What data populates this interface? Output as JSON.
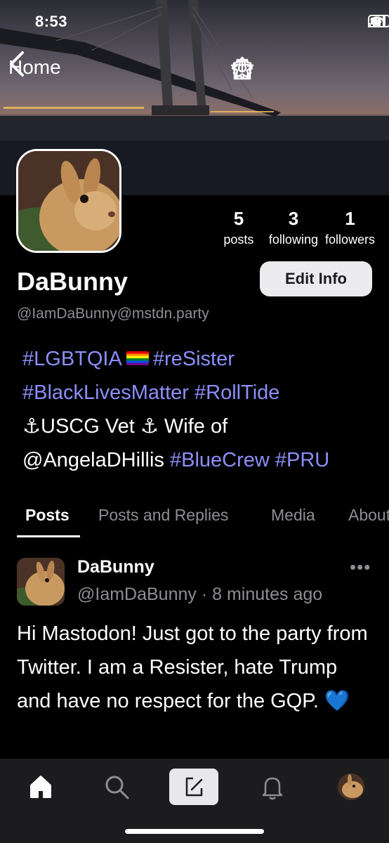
{
  "status": {
    "time": "8:53"
  },
  "nav": {
    "back_label": "Home"
  },
  "profile": {
    "display_name": "DaBunny",
    "handle": "@IamDaBunny@mstdn.party",
    "edit_label": "Edit Info",
    "stats": [
      {
        "value": "5",
        "label": "posts"
      },
      {
        "value": "3",
        "label": "following"
      },
      {
        "value": "1",
        "label": "followers"
      }
    ],
    "bio": {
      "tag_lgbtqia": "#LGBTQIA",
      "tag_resister": "#reSister",
      "tag_blm": "#BlackLivesMatter",
      "tag_rolltide": "#RollTide",
      "line3": "⚓USCG Vet ⚓ Wife of",
      "mention": "@AngelaDHillis",
      "tag_bluecrew": "#BlueCrew",
      "tag_pru": "#PRU"
    }
  },
  "tabs": [
    "Posts",
    "Posts and Replies",
    "Media",
    "About"
  ],
  "post": {
    "author": "DaBunny",
    "meta": "@IamDaBunny · 8 minutes ago",
    "more": "•••",
    "text": "Hi Mastodon! Just got to the party from Twitter. I am a Resister, hate Trump and have no respect for the GQP.",
    "emoji": "💙"
  },
  "colors": {
    "hashtag": "#8b8ff8",
    "secondary": "#8e8e93",
    "tabbar": "#1c1c1e"
  },
  "icons": [
    "back-chevron-icon",
    "star-icon",
    "share-icon",
    "gear-icon",
    "home-icon",
    "search-icon",
    "compose-icon",
    "bell-icon",
    "profile-avatar-icon"
  ]
}
